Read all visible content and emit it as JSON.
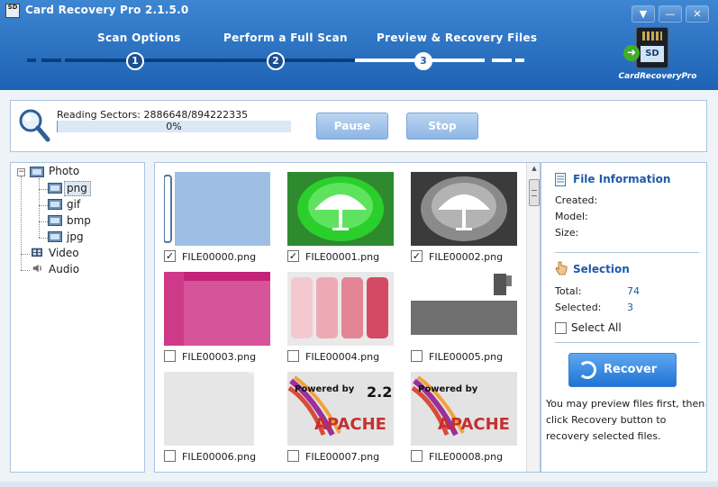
{
  "window": {
    "title": "Card Recovery Pro 2.1.5.0",
    "app_icon_text": "SD",
    "controls": {
      "menu": "▼",
      "minimize": "—",
      "close": "✕"
    }
  },
  "steps": [
    {
      "number": "1",
      "label": "Scan Options"
    },
    {
      "number": "2",
      "label": "Perform a Full Scan"
    },
    {
      "number": "3",
      "label": "Preview & Recovery Files"
    }
  ],
  "logo": {
    "card_label": "SD",
    "text": "CardRecoveryPro"
  },
  "progress": {
    "status": "Reading Sectors: 2886648/894222335",
    "percent_text": "0%",
    "fraction": 0.003,
    "pause_label": "Pause",
    "stop_label": "Stop"
  },
  "tree": {
    "toggle": "−",
    "root": "Photo",
    "children": [
      "png",
      "gif",
      "bmp",
      "jpg"
    ],
    "others": [
      "Video",
      "Audio"
    ]
  },
  "files": [
    {
      "name": "FILE00000.png",
      "checked": true
    },
    {
      "name": "FILE00001.png",
      "checked": true
    },
    {
      "name": "FILE00002.png",
      "checked": true
    },
    {
      "name": "FILE00003.png",
      "checked": false
    },
    {
      "name": "FILE00004.png",
      "checked": false
    },
    {
      "name": "FILE00005.png",
      "checked": false
    },
    {
      "name": "FILE00006.png",
      "checked": false
    },
    {
      "name": "FILE00007.png",
      "checked": false
    },
    {
      "name": "FILE00008.png",
      "checked": false
    }
  ],
  "thumb_text": {
    "powered_by": "Powered by",
    "apache": "APACHE",
    "version": "2.2"
  },
  "info": {
    "file_info_title": "File Information",
    "created_label": "Created:",
    "model_label": "Model:",
    "size_label": "Size:",
    "selection_title": "Selection",
    "total_label": "Total:",
    "total_value": "74",
    "selected_label": "Selected:",
    "selected_value": "3",
    "select_all_label": "Select All",
    "recover_label": "Recover",
    "help_text": "You may preview files first, then click Recovery button to recovery selected files."
  },
  "colors": {
    "header": "#1e62b4",
    "accent": "#1e5aa8",
    "button": "#1f73d4"
  }
}
